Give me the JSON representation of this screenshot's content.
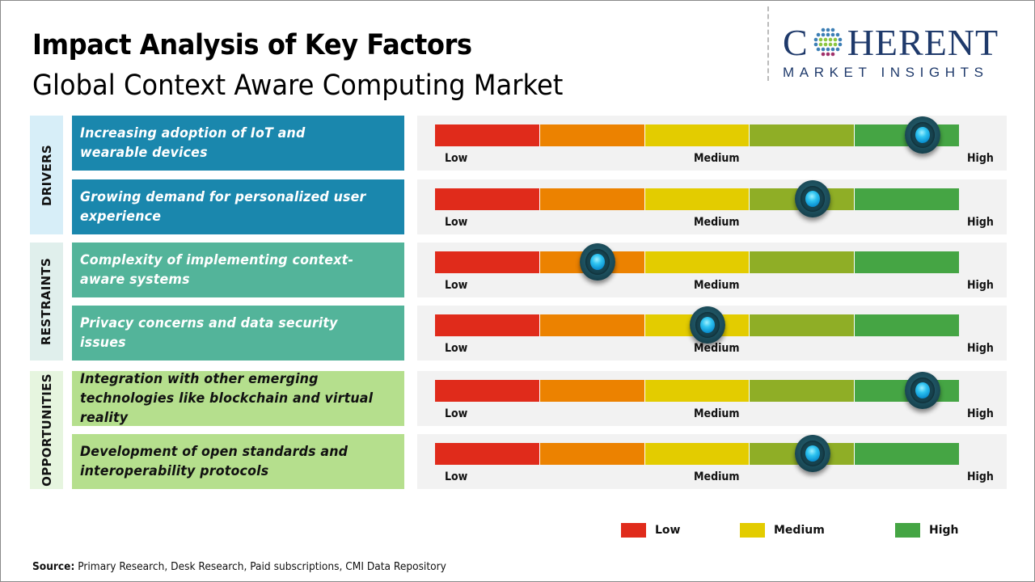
{
  "header": {
    "title": "Impact Analysis of Key Factors",
    "subtitle": "Global Context Aware Computing Market"
  },
  "logo": {
    "brand_pre": "C",
    "brand_post": "HERENT",
    "tagline": "MARKET INSIGHTS",
    "globe_icon": "globe-dots-icon",
    "colors": {
      "text": "#1f3a6b"
    }
  },
  "scale_labels": {
    "low": "Low",
    "medium": "Medium",
    "high": "High"
  },
  "segment_colors": [
    "#e02b1b",
    "#ec8200",
    "#e3cc00",
    "#8fae26",
    "#45a544"
  ],
  "categories": [
    {
      "label": "DRIVERS",
      "bg": "#d7eef8",
      "factor_bg": "#1a87ad",
      "factor_text": "#ffffff"
    },
    {
      "label": "RESTRAINTS",
      "bg": "#e0efec",
      "factor_bg": "#53b49a",
      "factor_text": "#ffffff"
    },
    {
      "label": "OPPORTUNITIES",
      "bg": "#e6f5df",
      "factor_bg": "#b5df8d",
      "factor_text": "#111111"
    }
  ],
  "chart_data": {
    "type": "table",
    "title": "Impact Analysis of Key Factors - Global Context Aware Computing Market",
    "scale": {
      "min_label": "Low",
      "mid_label": "Medium",
      "max_label": "High",
      "range": [
        0,
        1
      ]
    },
    "rows": [
      {
        "category": "DRIVERS",
        "factor": "Increasing adoption of IoT and wearable devices",
        "impact": 0.93,
        "impact_level": "High"
      },
      {
        "category": "DRIVERS",
        "factor": "Growing demand for personalized user experience",
        "impact": 0.72,
        "impact_level": "Medium-High"
      },
      {
        "category": "RESTRAINTS",
        "factor": "Complexity of implementing context-aware systems",
        "impact": 0.31,
        "impact_level": "Low-Medium"
      },
      {
        "category": "RESTRAINTS",
        "factor": "Privacy concerns and data security issues",
        "impact": 0.52,
        "impact_level": "Medium"
      },
      {
        "category": "OPPORTUNITIES",
        "factor": "Integration with other emerging technologies like blockchain and virtual reality",
        "impact": 0.93,
        "impact_level": "High"
      },
      {
        "category": "OPPORTUNITIES",
        "factor": "Development of open standards and interoperability protocols",
        "impact": 0.72,
        "impact_level": "Medium-High"
      }
    ],
    "legend": [
      {
        "label": "Low",
        "color": "#e02b1b"
      },
      {
        "label": "Medium",
        "color": "#e3cc00"
      },
      {
        "label": "High",
        "color": "#45a544"
      }
    ],
    "legend_position": "bottom-right"
  },
  "footer": {
    "source_label": "Source:",
    "source_text": " Primary Research, Desk Research, Paid subscriptions, CMI Data Repository"
  }
}
